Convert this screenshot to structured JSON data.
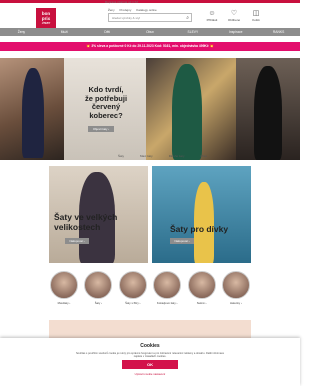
{
  "topbar": {
    "note": "Doprava zdarma od 1 Kč"
  },
  "logo": {
    "line1": "bon",
    "line2": "prix",
    "line3": "ÜTEBY"
  },
  "subnav": [
    "Ženy",
    "Prodejny",
    "Katalogy online"
  ],
  "search": {
    "placeholder": "Hledat výrobky & styl"
  },
  "util": {
    "login": "Přihlásit",
    "wishlist": "Oblíbené",
    "cart": "Košík"
  },
  "nav": [
    "Ženy",
    "Muži",
    "Děti",
    "Obuv",
    "SLEVY",
    "Inspirace",
    "RANKS"
  ],
  "promo": "💥 3% sleva a poštovné 0 Kč do 29.11.2023 Kód: 5161, min. objednávka 499Kč 💥",
  "hero": {
    "line1": "Kdo tvrdí,",
    "line2": "že potřebuji",
    "line3": "červený koberec?",
    "button": "Objevit šaty ›"
  },
  "slider_labels": [
    "Šaty",
    "Maxi šaty",
    "Dlouhé šaty",
    "Plisé"
  ],
  "cards": [
    {
      "line1": "Šaty ve velkých",
      "line2": "velikostech",
      "button": "Nakupovat ›"
    },
    {
      "line1": "Šaty pro dívky",
      "button": "Nakupovat ›"
    }
  ],
  "categories": [
    "Maxišaty ›",
    "Šaty ›",
    "Šaty s flitry ›",
    "Koktejlové šaty ›",
    "Sukně ›",
    "Halenky ›"
  ],
  "cookie": {
    "title": "Cookies",
    "text": "Souhlas s použitím souborů cookie je nutný pro správné fungování a pro zobrazení relevantní reklamy a obsahu. Další informace najdete v zásadách cookies.",
    "ok": "OK",
    "settings": "Upravit cookie nastavení"
  },
  "colors": {
    "brand": "#c8103e",
    "promo": "#e30e6c",
    "nav": "#8d8d8d"
  }
}
